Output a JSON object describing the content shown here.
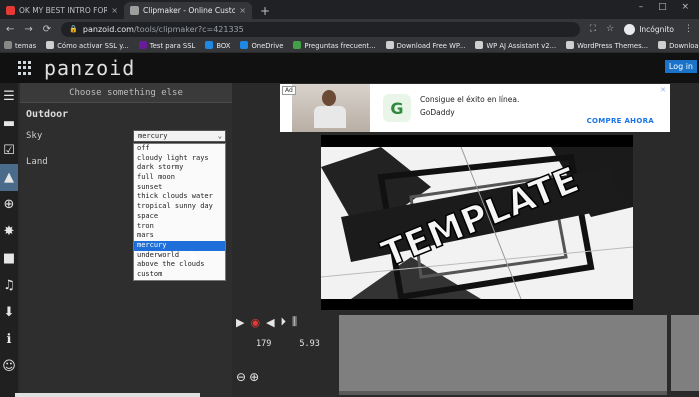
{
  "browser": {
    "tabs": [
      {
        "title": "OK MY BEST INTRO FOR SURE C",
        "close": "×",
        "favicon_color": "#e53935"
      },
      {
        "title": "Clipmaker - Online Custom Intro",
        "close": "×",
        "favicon_color": "#9e9e9e"
      }
    ],
    "new_tab": "+",
    "window_controls": "– □ ×",
    "nav": {
      "back": "←",
      "forward": "→",
      "reload": "⟳"
    },
    "url_host": "panzoid.com",
    "url_path": "/tools/clipmaker?c=421335",
    "lock": "🔒",
    "profile": "Incógnito",
    "bookmarks": [
      {
        "label": "temas",
        "color": "#888888"
      },
      {
        "label": "Cómo activar SSL y...",
        "color": "#cfcfcf"
      },
      {
        "label": "Test para SSL",
        "color": "#6a1b9a"
      },
      {
        "label": "BOX",
        "color": "#1e88e5"
      },
      {
        "label": "OneDrive",
        "color": "#1e88e5"
      },
      {
        "label": "Preguntas frecuent...",
        "color": "#43a047"
      },
      {
        "label": "Download Free WP...",
        "color": "#cfcfcf"
      },
      {
        "label": "WP AJ Assistant v2...",
        "color": "#cfcfcf"
      },
      {
        "label": "WordPress Themes...",
        "color": "#cfcfcf"
      },
      {
        "label": "Download Free Astr...",
        "color": "#cfcfcf"
      }
    ]
  },
  "header": {
    "logo": "panzoid",
    "login": "Log in"
  },
  "sidebar_icons": [
    "menu-icon",
    "folder-icon",
    "checkbox-icon",
    "landscape-icon",
    "globe-icon",
    "burst-icon",
    "camera-icon",
    "music-icon",
    "download-icon",
    "info-icon",
    "smiley-icon"
  ],
  "panel": {
    "choose": "Choose something else",
    "title": "Outdoor",
    "sky_label": "Sky",
    "land_label": "Land",
    "sky_value": "mercury",
    "sky_options": [
      "off",
      "cloudy light rays",
      "dark stormy",
      "full moon",
      "sunset",
      "thick clouds water",
      "tropical sunny day",
      "space",
      "tron",
      "mars",
      "mercury",
      "underworld",
      "above the clouds",
      "custom"
    ],
    "selected_index": 10
  },
  "ad": {
    "tag": "Ad",
    "line1": "Consigue el éxito en línea.",
    "line2": "GoDaddy",
    "cta": "COMPRE AHORA"
  },
  "preview": {
    "text": "TEMPLATE"
  },
  "timeline": {
    "frame": "179",
    "time": "5.93"
  }
}
